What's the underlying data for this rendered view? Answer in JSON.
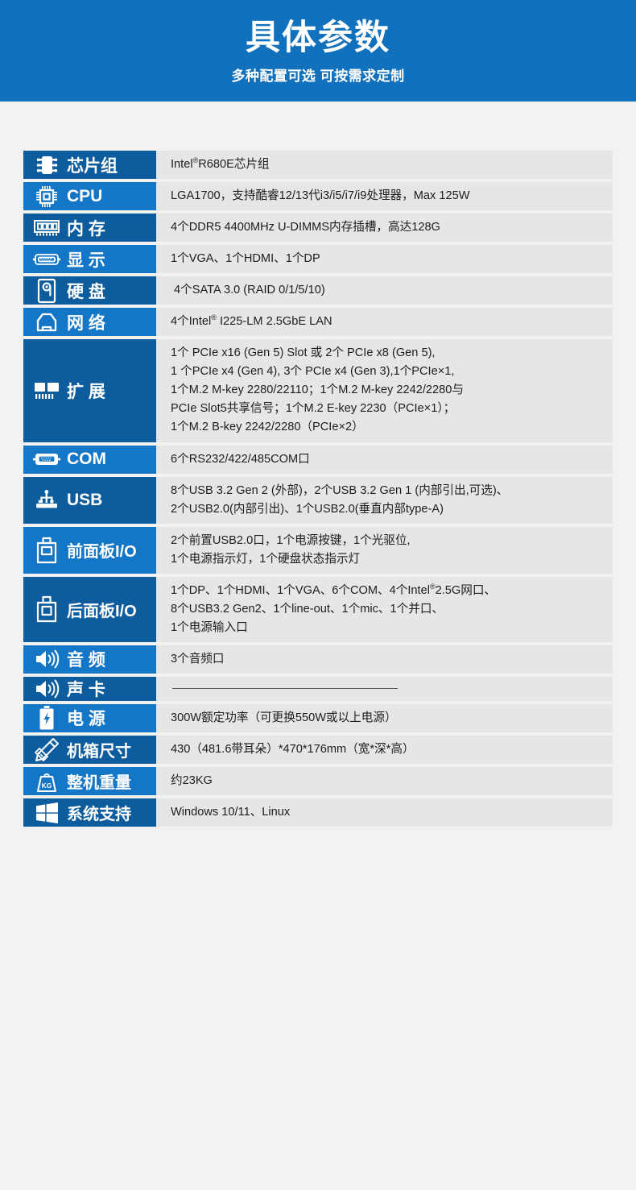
{
  "banner": {
    "title": "具体参数",
    "subtitle": "多种配置可选 可按需求定制",
    "bg_color": "#1271bd"
  },
  "colors": {
    "label_dark": "#0d5c9e",
    "label_light": "#1476c6",
    "value_bg": "#e6e6e6",
    "page_bg": "#f2f2f2",
    "value_text": "#1d1d1d"
  },
  "spec_rows": [
    {
      "icon": "chipset-icon",
      "label": "芯片组",
      "lines": [
        "Intel®R680E芯片组"
      ]
    },
    {
      "icon": "cpu-icon",
      "label": "CPU",
      "lines": [
        "LGA1700，支持酷睿12/13代i3/i5/i7/i9处理器，Max 125W"
      ]
    },
    {
      "icon": "memory-icon",
      "label": "内 存",
      "lines": [
        "4个DDR5 4400MHz U-DIMMS内存插槽，高达128G"
      ]
    },
    {
      "icon": "vga-display-icon",
      "label": "显 示",
      "lines": [
        "1个VGA、1个HDMI、1个DP"
      ]
    },
    {
      "icon": "harddisk-icon",
      "label": "硬 盘",
      "lines": [
        " 4个SATA 3.0 (RAID 0/1/5/10)"
      ]
    },
    {
      "icon": "network-icon",
      "label": "网 络",
      "lines": [
        "4个Intel® I225-LM 2.5GbE LAN"
      ]
    },
    {
      "icon": "expansion-card-icon",
      "label": "扩 展",
      "lines": [
        "1个 PCIe x16 (Gen 5) Slot 或 2个 PCIe x8 (Gen 5),",
        "1 个PCIe x4 (Gen 4), 3个 PCIe x4 (Gen 3),1个PCIe×1,",
        "1个M.2 M-key 2280/22110；1个M.2 M-key 2242/2280与",
        "PCIe Slot5共享信号；1个M.2 E-key 2230（PCIe×1）；",
        "1个M.2 B-key 2242/2280（PCIe×2）"
      ]
    },
    {
      "icon": "com-port-icon",
      "label": "COM",
      "lines": [
        "6个RS232/422/485COM口"
      ]
    },
    {
      "icon": "usb-icon",
      "label": "USB",
      "lines": [
        "8个USB 3.2 Gen 2 (外部)，2个USB 3.2 Gen 1 (内部引出,可选)、",
        "2个USB2.0(内部引出)、1个USB2.0(垂直内部type-A)"
      ]
    },
    {
      "icon": "front-panel-io-icon",
      "label": "前面板I/O",
      "lines": [
        "2个前置USB2.0口，1个电源按键，1个光驱位,",
        "1个电源指示灯，1个硬盘状态指示灯"
      ]
    },
    {
      "icon": "rear-panel-io-icon",
      "label": "后面板I/O",
      "lines": [
        "1个DP、1个HDMI、1个VGA、6个COM、4个Intel®2.5G网口、",
        "8个USB3.2 Gen2、1个line-out、1个mic、1个并口、",
        "1个电源输入口"
      ]
    },
    {
      "icon": "audio-speaker-icon",
      "label": "音 频",
      "lines": [
        "3个音频口"
      ]
    },
    {
      "icon": "sound-card-speaker-icon",
      "label": "声 卡",
      "lines": [
        ""
      ],
      "rule": true
    },
    {
      "icon": "power-battery-icon",
      "label": "电 源",
      "lines": [
        "300W额定功率（可更换550W或以上电源）"
      ]
    },
    {
      "icon": "chassis-dimension-icon",
      "label": "机箱尺寸",
      "lines": [
        "430（481.6带耳朵）*470*176mm（宽*深*高）"
      ]
    },
    {
      "icon": "weight-kg-icon",
      "label": "整机重量",
      "lines": [
        "约23KG"
      ]
    },
    {
      "icon": "windows-logo-icon",
      "label": "系统支持",
      "lines": [
        "Windows 10/11、Linux"
      ]
    }
  ]
}
